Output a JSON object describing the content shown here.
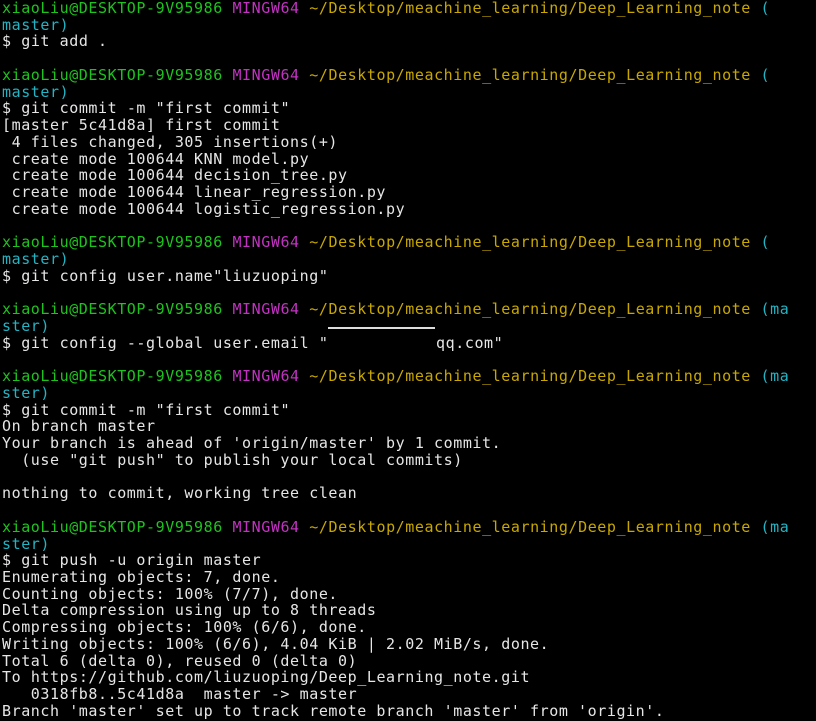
{
  "colors": {
    "background": "#000000",
    "foreground": "#e6e6e6",
    "user_host": "#1ec41e",
    "system": "#c233c2",
    "cwd": "#c8a800",
    "branch": "#23b4c4",
    "redaction": "#dcdcdc"
  },
  "prompt": {
    "user_host": "xiaoLiu@DESKTOP-9V95986",
    "system": "MINGW64",
    "cwd": "~/Desktop/meachine_learning/Deep_Learning_note",
    "symbol": "$"
  },
  "blocks": [
    {
      "branch": [
        "(",
        "master)"
      ],
      "command": "git add .",
      "output": []
    },
    {
      "branch": [
        "(",
        "master)"
      ],
      "command": "git commit -m \"first commit\"",
      "output": [
        "[master 5c41d8a] first commit",
        " 4 files changed, 305 insertions(+)",
        " create mode 100644 KNN_model.py",
        " create mode 100644 decision_tree.py",
        " create mode 100644 linear_regression.py",
        " create mode 100644 logistic_regression.py"
      ]
    },
    {
      "branch": [
        "(",
        "master)"
      ],
      "command": "git config user.name\"liuzuoping\"",
      "output": []
    },
    {
      "branch": [
        "(ma",
        "ster)"
      ],
      "command": "git config --global user.email \"",
      "command_tail": "qq.com\"",
      "output": []
    },
    {
      "branch": [
        "(ma",
        "ster)"
      ],
      "command": "git commit -m \"first commit\"",
      "output": [
        "On branch master",
        "Your branch is ahead of 'origin/master' by 1 commit.",
        "  (use \"git push\" to publish your local commits)",
        "nothing to commit, working tree clean"
      ]
    },
    {
      "branch": [
        "(ma",
        "ster)"
      ],
      "command": "git push -u origin master",
      "output": [
        "Enumerating objects: 7, done.",
        "Counting objects: 100% (7/7), done.",
        "Delta compression using up to 8 threads",
        "Compressing objects: 100% (6/6), done.",
        "Writing objects: 100% (6/6), 4.04 KiB | 2.02 MiB/s, done.",
        "Total 6 (delta 0), reused 0 (delta 0)",
        {
          "prefix": "To",
          "url": "https://github.com/liuzuoping/Deep_Learning_note.git"
        },
        "   0318fb8..5c41d8a  master -> master",
        "Branch 'master' set up to track remote branch 'master' from 'origin'."
      ]
    }
  ]
}
